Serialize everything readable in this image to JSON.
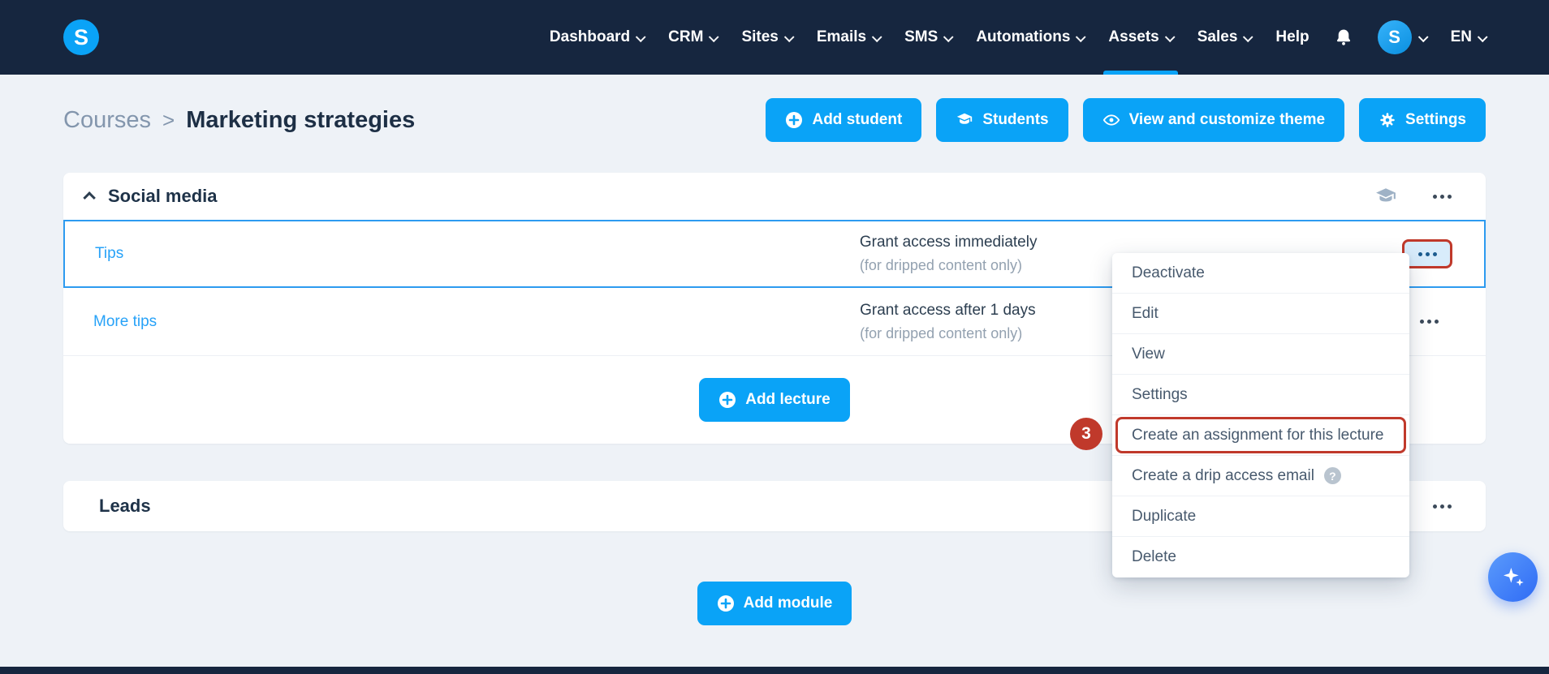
{
  "colors": {
    "navbar_bg": "#16263f",
    "accent_blue": "#0aa3f7",
    "annotation_red": "#c0392b",
    "row_highlight_border": "#2d9bf0",
    "link_blue": "#27a2f8"
  },
  "navbar": {
    "logo_letter": "S",
    "avatar_letter": "S",
    "language": "EN",
    "items": [
      {
        "label": "Dashboard",
        "has_caret": true
      },
      {
        "label": "CRM",
        "has_caret": true
      },
      {
        "label": "Sites",
        "has_caret": true
      },
      {
        "label": "Emails",
        "has_caret": true
      },
      {
        "label": "SMS",
        "has_caret": true
      },
      {
        "label": "Automations",
        "has_caret": true
      },
      {
        "label": "Assets",
        "has_caret": true,
        "active": true
      },
      {
        "label": "Sales",
        "has_caret": true
      },
      {
        "label": "Help",
        "has_caret": false
      }
    ]
  },
  "breadcrumb": {
    "parent": "Courses",
    "separator": ">",
    "current": "Marketing strategies"
  },
  "toolbar": {
    "actions": [
      {
        "label": "Add student",
        "icon": "plus-circle-icon"
      },
      {
        "label": "Students",
        "icon": "students-icon"
      },
      {
        "label": "View and customize theme",
        "icon": "eye-icon"
      },
      {
        "label": "Settings",
        "icon": "gear-icon"
      }
    ]
  },
  "modules": {
    "social": {
      "title": "Social media",
      "lectures": [
        {
          "name": "Tips",
          "access": "Grant access immediately",
          "note": "(for dripped content only)"
        },
        {
          "name": "More tips",
          "access": "Grant access after 1 days",
          "note": "(for dripped content only)"
        }
      ],
      "add_lecture_label": "Add lecture"
    },
    "leads": {
      "title": "Leads"
    },
    "add_module_label": "Add module"
  },
  "context_menu": {
    "items": [
      "Deactivate",
      "Edit",
      "View",
      "Settings",
      "Create an assignment for this lecture",
      "Create a drip access email",
      "Duplicate",
      "Delete"
    ],
    "highlighted_item": "Create an assignment for this lecture",
    "question_badge": "?"
  },
  "annotations": {
    "step_badge": "3"
  }
}
